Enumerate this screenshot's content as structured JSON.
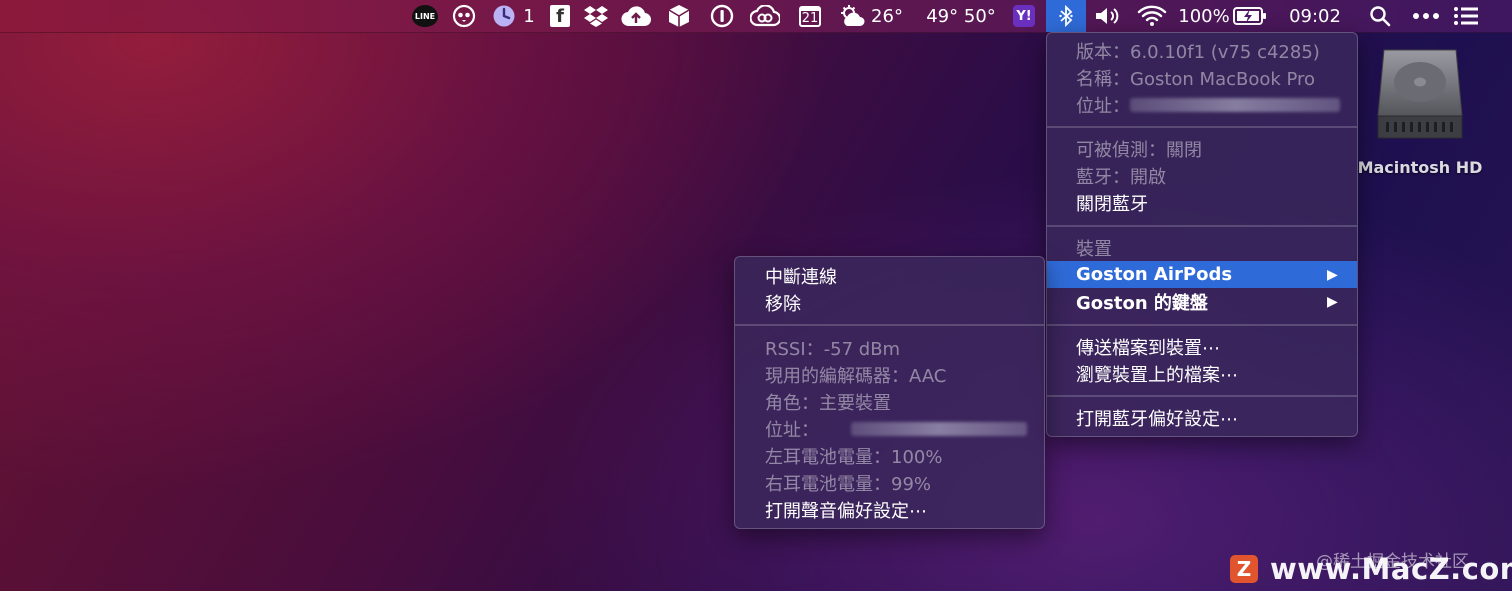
{
  "menubar": {
    "line_badge": "LINE",
    "notification_count": "1",
    "calendar_day": "21",
    "weather_temp": "26°",
    "temps": "49° 50°",
    "yahoo_badge": "Y!",
    "battery": "100%",
    "clock": "09:02",
    "icons": [
      "line-icon",
      "owl-icon",
      "clock-icon",
      "facebook-icon",
      "dropbox-icon",
      "cloud-upload-icon",
      "box-icon",
      "1password-icon",
      "creative-cloud-icon",
      "calendar-icon",
      "weather-icon",
      "yahoo-icon",
      "bluetooth-icon",
      "volume-icon",
      "wifi-icon",
      "battery-icon",
      "search-icon",
      "more-icon",
      "list-icon"
    ]
  },
  "bluetooth_menu": {
    "version": "版本：6.0.10f1 (v75 c4285)",
    "name": "名稱：Goston MacBook Pro",
    "address_label": "位址：",
    "discoverable": "可被偵測：關閉",
    "bluetooth_state": "藍牙：開啟",
    "turn_off": "關閉藍牙",
    "devices_header": "裝置",
    "device_airpods": "Goston AirPods",
    "device_keyboard": "Goston 的鍵盤",
    "send_file": "傳送檔案到裝置⋯",
    "browse_files": "瀏覽裝置上的檔案⋯",
    "open_prefs": "打開藍牙偏好設定⋯"
  },
  "airpods_submenu": {
    "disconnect": "中斷連線",
    "remove": "移除",
    "rssi": "RSSI：-57 dBm",
    "codec": "現用的編解碼器：AAC",
    "role": "角色：主要裝置",
    "address_label": "位址：",
    "left_battery": "左耳電池電量：100%",
    "right_battery": "右耳電池電量：99%",
    "sound_prefs": "打開聲音偏好設定⋯"
  },
  "desktop": {
    "hd_label": "Macintosh HD"
  },
  "watermark": {
    "top_text": "@稀土掘金技术社区",
    "logo_letter": "Z",
    "site": "www.MacZ.com"
  },
  "colors": {
    "highlight": "#2f6bd8",
    "menu_bg": "#3a285c"
  }
}
